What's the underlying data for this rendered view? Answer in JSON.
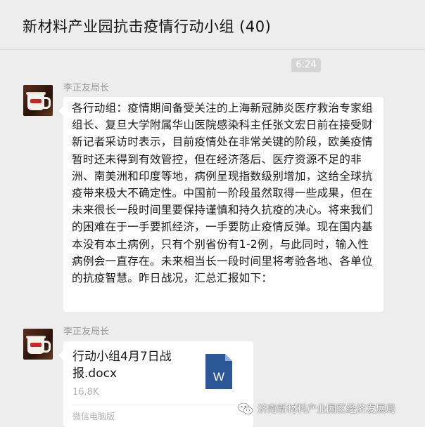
{
  "chat": {
    "title": "新材料产业园抗击疫情行动小组 (40)"
  },
  "timestamp": "6:24",
  "messages": [
    {
      "sender": "李正友局长",
      "type": "text",
      "text": "各行动组：疫情期间备受关注的上海新冠肺炎医疗救治专家组组长、复旦大学附属华山医院感染科主任张文宏日前在接受财新记者采访时表示，目前疫情处在非常关键的阶段，欧美疫情暂时还未得到有效管控，但在经济落后、医疗资源不足的非洲、南美洲和印度等地，病例呈现指数级别增加，这给全球抗疫带来极大不确定性。中国前一阶段虽然取得一些成果，但在未来很长一段时间里要保持谨慎和持久抗疫的决心。将来我们的困难在于一手要抓经济，一手要防止疫情反弹。现在国内基本没有本土病例，只有个别省份有1-2例，与此同时，输入性病例会一直存在。未来相当长一段时间里将考验各地、各单位的抗疫智慧。昨日战况，汇总汇报如下："
    },
    {
      "sender": "李正友局长",
      "type": "file",
      "file_name": "行动小组4月7日战报.docx",
      "file_size": "16.8K",
      "file_icon": "word-document-icon",
      "file_icon_letter": "W",
      "source": "微信电脑版"
    }
  ],
  "watermark": {
    "icon": "wechat-icon",
    "text": "济南新材料产业园区经济发展局"
  },
  "colors": {
    "background": "#ededed",
    "bubble": "#ffffff",
    "word_blue": "#2b5797",
    "meta_gray": "#999999"
  }
}
